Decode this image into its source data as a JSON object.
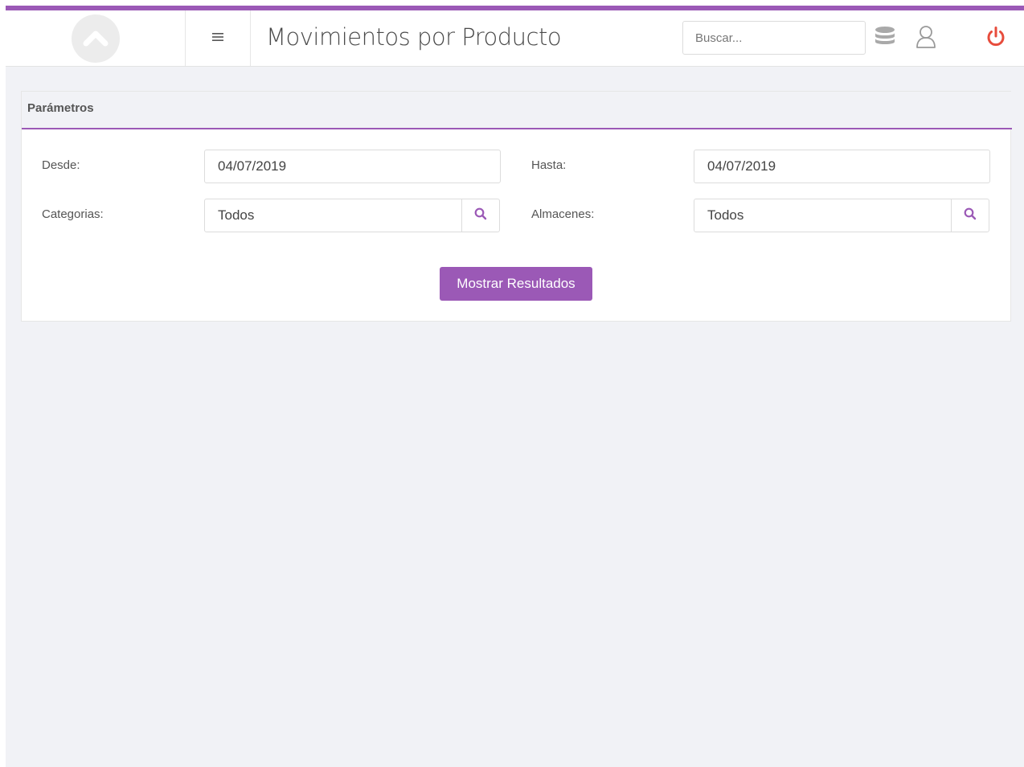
{
  "header": {
    "title": "Movimientos por Producto",
    "search_placeholder": "Buscar..."
  },
  "icons": {
    "logo": "logo-icon",
    "menu": "hamburger-menu-icon",
    "database": "database-icon",
    "user": "user-icon",
    "power": "power-icon",
    "search": "search-icon"
  },
  "colors": {
    "accent": "#9b59b6",
    "power": "#e74c3c",
    "background": "#f1f2f6"
  },
  "parametros": {
    "title": "Parámetros",
    "desde_label": "Desde:",
    "desde_value": "04/07/2019",
    "hasta_label": "Hasta:",
    "hasta_value": "04/07/2019",
    "categorias_label": "Categorias:",
    "categorias_value": "Todos",
    "almacenes_label": "Almacenes:",
    "almacenes_value": "Todos",
    "submit_label": "Mostrar Resultados"
  }
}
